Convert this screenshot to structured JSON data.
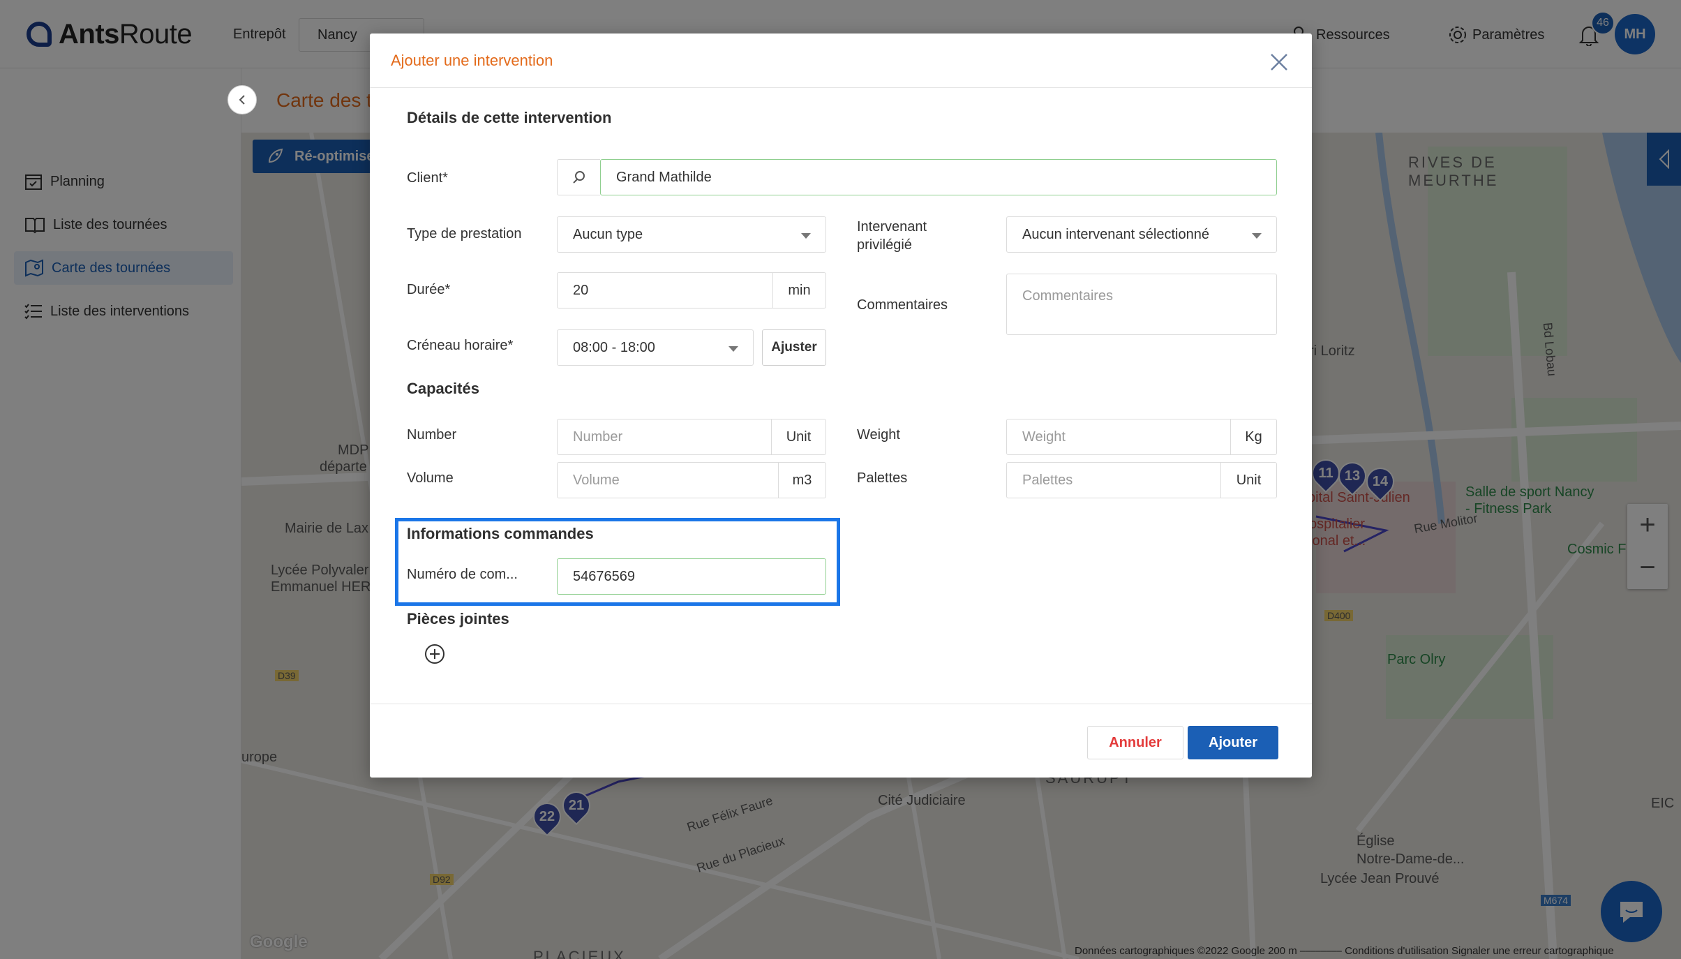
{
  "app": {
    "logo_text_bold": "Ants",
    "logo_text_rest": "Route"
  },
  "header": {
    "warehouse_label": "Entrepôt",
    "warehouse_value": "Nancy",
    "resources_label": "Ressources",
    "settings_label": "Paramètres",
    "notification_count": "46",
    "avatar_initials": "MH"
  },
  "sidebar": {
    "items": [
      {
        "label": "Planning",
        "icon": "calendar-check-icon"
      },
      {
        "label": "Liste des tournées",
        "icon": "book-icon"
      },
      {
        "label": "Carte des tournées",
        "icon": "map-pin-icon",
        "active": true
      },
      {
        "label": "Liste des interventions",
        "icon": "list-icon"
      }
    ]
  },
  "page": {
    "title": "Carte des t",
    "reoptimize_label": "Ré-optimise"
  },
  "map": {
    "labels": {
      "rives": "RIVES DE",
      "meurthe": "MEURTHE",
      "saurupt": "SAURUPT",
      "placieux": "PLACIEUX",
      "sport": "Salle de sport Nancy",
      "fitness": "- Fitness Park",
      "parc_olry": "Parc Olry",
      "cite": "Cité Judiciaire",
      "eglise1": "Église",
      "eglise2": "Notre-Dame-de...",
      "lycee_jp": "Lycée Jean Prouvé",
      "mairie": "Mairie de Lax",
      "lycee_poly1": "Lycée Polyvaler",
      "lycee_poly2": "Emmanuel HER",
      "mdp1": "MDP",
      "mdp2": "départe",
      "cosmic": "Cosmic F",
      "europe": "urope",
      "loritz": "ri Loritz",
      "hopital1": "pital Saint-Julien",
      "hopital2": "ospitalier",
      "hopital3": "ional et...",
      "rue_felix": "Rue Félix Faure",
      "rue_placieux": "Rue du Placieux",
      "bd_lobau": "Bd Lobau",
      "rue_molitor": "Rue Molitor",
      "eic": "EIC",
      "d400": "D400",
      "d39": "D39",
      "d92": "D92",
      "m674": "M674"
    },
    "pins": [
      "22",
      "21",
      "14",
      "13",
      "11"
    ],
    "footer": "Données cartographiques ©2022 Google    200 m ⎯⎯⎯⎯⎯⎯⎯⎯    Conditions d'utilisation    Signaler une erreur cartographique",
    "google": "Google",
    "zoom_in": "+",
    "zoom_out": "−"
  },
  "modal": {
    "title": "Ajouter une intervention",
    "details_title": "Détails de cette intervention",
    "client_label": "Client*",
    "client_value": "Grand Mathilde",
    "service_type_label": "Type de prestation",
    "service_type_value": "Aucun type",
    "preferred_worker_label_1": "Intervenant",
    "preferred_worker_label_2": "privilégié",
    "preferred_worker_value": "Aucun intervenant sélectionné",
    "duration_label": "Durée*",
    "duration_value": "20",
    "duration_unit": "min",
    "comments_label": "Commentaires",
    "comments_placeholder": "Commentaires",
    "timeslot_label": "Créneau horaire*",
    "timeslot_value": "08:00 - 18:00",
    "adjust_label": "Ajuster",
    "capacities_title": "Capacités",
    "number_label": "Number",
    "number_placeholder": "Number",
    "number_unit": "Unit",
    "weight_label": "Weight",
    "weight_placeholder": "Weight",
    "weight_unit": "Kg",
    "volume_label": "Volume",
    "volume_placeholder": "Volume",
    "volume_unit": "m3",
    "pallets_label": "Palettes",
    "pallets_placeholder": "Palettes",
    "pallets_unit": "Unit",
    "order_info_title": "Informations commandes",
    "order_number_label": "Numéro de com...",
    "order_number_value": "54676569",
    "attachments_title": "Pièces jointes",
    "cancel_label": "Annuler",
    "add_label": "Ajouter"
  },
  "colors": {
    "accent_orange": "#e36b1c",
    "primary_blue": "#1b5fb5",
    "highlight_blue": "#1b76e8",
    "cancel_red": "#e33b3b",
    "valid_green": "#8fcf8f"
  }
}
